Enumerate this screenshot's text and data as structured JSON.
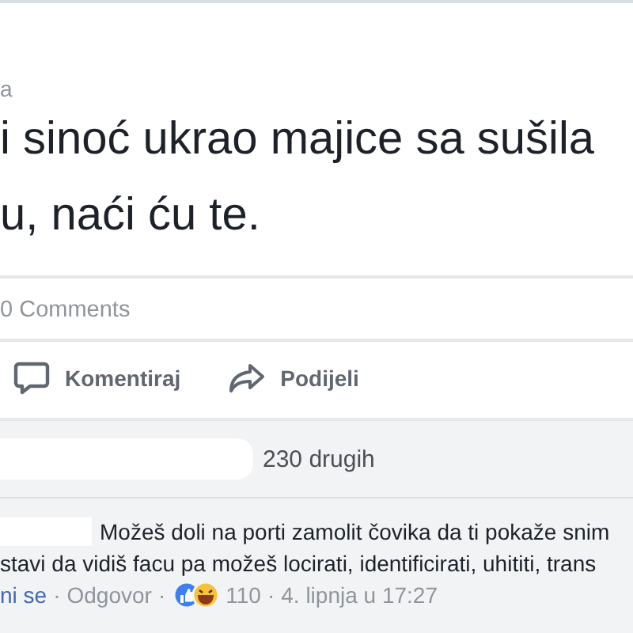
{
  "post": {
    "author": "a",
    "text_lines": [
      "i sinoć ukrao majice sa sušila",
      "u, naći ću te."
    ],
    "comments_count": "0 Comments"
  },
  "actions": [
    {
      "kind": "comment",
      "label": "Komentiraj"
    },
    {
      "kind": "share",
      "label": "Podijeli"
    }
  ],
  "reactions_summary": "230 drugih",
  "comment": {
    "text_lines": [
      "Možeš doli na porti zamolit čovika da ti pokaže snim",
      "stavi da vidiš facu pa možeš locirati, identificirati, uhititi, trans"
    ],
    "like_link": "ni se",
    "reply_link": "Odgovor",
    "separator": "·",
    "reaction_count": "110",
    "time": "4. lipnja u 17:27"
  }
}
